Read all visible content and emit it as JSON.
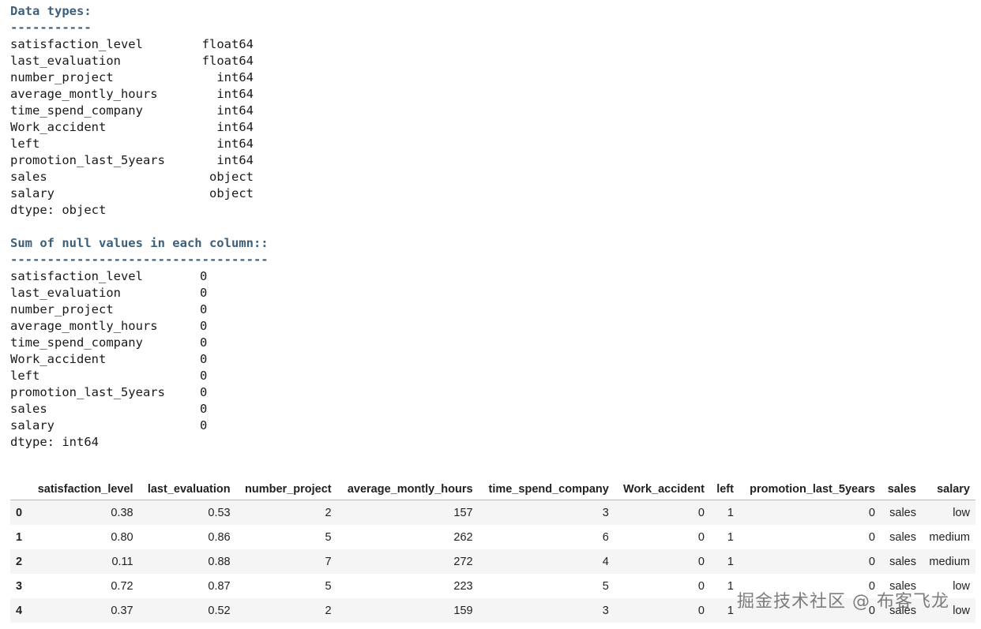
{
  "dtypes": {
    "heading": "Data types:",
    "underline": "-----------",
    "rows": [
      {
        "name": "satisfaction_level",
        "value": "float64"
      },
      {
        "name": "last_evaluation",
        "value": "float64"
      },
      {
        "name": "number_project",
        "value": "int64"
      },
      {
        "name": "average_montly_hours",
        "value": "int64"
      },
      {
        "name": "time_spend_company",
        "value": "int64"
      },
      {
        "name": "Work_accident",
        "value": "int64"
      },
      {
        "name": "left",
        "value": "int64"
      },
      {
        "name": "promotion_last_5years",
        "value": "int64"
      },
      {
        "name": "sales",
        "value": "object"
      },
      {
        "name": "salary",
        "value": "object"
      }
    ],
    "footer": "dtype: object"
  },
  "nulls": {
    "heading": "Sum of null values in each column::",
    "underline": "-----------------------------------",
    "rows": [
      {
        "name": "satisfaction_level",
        "value": "0"
      },
      {
        "name": "last_evaluation",
        "value": "0"
      },
      {
        "name": "number_project",
        "value": "0"
      },
      {
        "name": "average_montly_hours",
        "value": "0"
      },
      {
        "name": "time_spend_company",
        "value": "0"
      },
      {
        "name": "Work_accident",
        "value": "0"
      },
      {
        "name": "left",
        "value": "0"
      },
      {
        "name": "promotion_last_5years",
        "value": "0"
      },
      {
        "name": "sales",
        "value": "0"
      },
      {
        "name": "salary",
        "value": "0"
      }
    ],
    "footer": "dtype: int64"
  },
  "table": {
    "index_header": "",
    "columns": [
      "satisfaction_level",
      "last_evaluation",
      "number_project",
      "average_montly_hours",
      "time_spend_company",
      "Work_accident",
      "left",
      "promotion_last_5years",
      "sales",
      "salary"
    ],
    "rows": [
      {
        "index": "0",
        "cells": [
          "0.38",
          "0.53",
          "2",
          "157",
          "3",
          "0",
          "1",
          "0",
          "sales",
          "low"
        ]
      },
      {
        "index": "1",
        "cells": [
          "0.80",
          "0.86",
          "5",
          "262",
          "6",
          "0",
          "1",
          "0",
          "sales",
          "medium"
        ]
      },
      {
        "index": "2",
        "cells": [
          "0.11",
          "0.88",
          "7",
          "272",
          "4",
          "0",
          "1",
          "0",
          "sales",
          "medium"
        ]
      },
      {
        "index": "3",
        "cells": [
          "0.72",
          "0.87",
          "5",
          "223",
          "5",
          "0",
          "1",
          "0",
          "sales",
          "low"
        ]
      },
      {
        "index": "4",
        "cells": [
          "0.37",
          "0.52",
          "2",
          "159",
          "3",
          "0",
          "1",
          "0",
          "sales",
          "low"
        ]
      }
    ]
  },
  "watermark": "掘金技术社区 @ 布客飞龙"
}
